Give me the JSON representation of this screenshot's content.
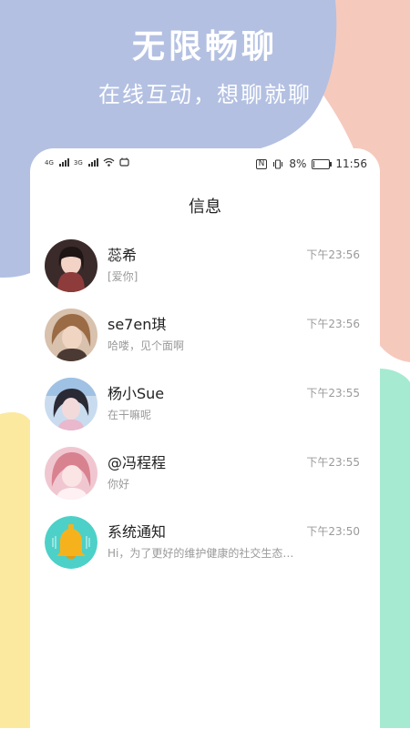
{
  "hero": {
    "title": "无限畅聊",
    "subtitle": "在线互动，想聊就聊"
  },
  "status_bar": {
    "signal_1_label": "4G",
    "signal_2_label": "3G",
    "battery_percent": "8%",
    "battery_level": 0.08,
    "time": "11:56",
    "nfc_label": "N"
  },
  "page": {
    "title": "信息"
  },
  "conversations": [
    {
      "name": "蕊希",
      "message": "[爱你]",
      "time": "下午23:56",
      "avatar_color": "#3a2a2a"
    },
    {
      "name": "se7en琪",
      "message": "哈喽，见个面啊",
      "time": "下午23:56",
      "avatar_color": "#c9a38a"
    },
    {
      "name": "杨小Sue",
      "message": "在干嘛呢",
      "time": "下午23:55",
      "avatar_color": "#b9d3ea"
    },
    {
      "name": "@冯程程",
      "message": "你好",
      "time": "下午23:55",
      "avatar_color": "#e7aab8"
    },
    {
      "name": "系统通知",
      "message": "Hi，为了更好的维护健康的社交生态…",
      "time": "下午23:50",
      "avatar_color": "#4dd0c8"
    }
  ],
  "colors": {
    "blob_blue": "#b3c0e2",
    "blob_pink": "#f6c9bd",
    "blob_yellow": "#fbe9a0",
    "blob_mint": "#a6ead2",
    "bell": "#f6b21d"
  }
}
